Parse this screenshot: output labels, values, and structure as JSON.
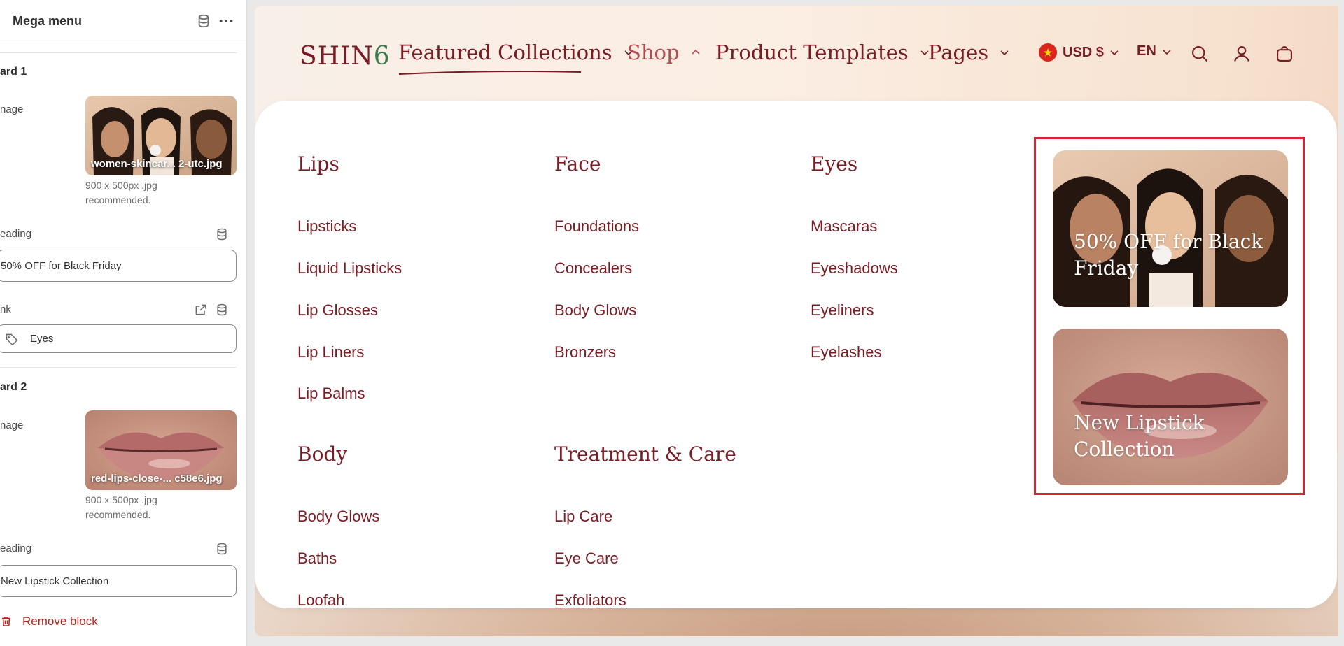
{
  "panel": {
    "title": "Mega menu",
    "card1": {
      "title": "ard 1",
      "image_label": "nage",
      "image_name": "women-skincar... 2-utc.jpg",
      "hint": "900 x 500px .jpg recommended.",
      "heading_label": "eading",
      "heading_value": "50% OFF for Black Friday",
      "link_label": "nk",
      "link_value": "Eyes"
    },
    "card2": {
      "title": "ard 2",
      "image_label": "nage",
      "image_name": "red-lips-close-... c58e6.jpg",
      "hint": "900 x 500px .jpg recommended.",
      "heading_label": "eading",
      "heading_value": "New Lipstick Collection"
    },
    "remove_label": "Remove block"
  },
  "store": {
    "logo": {
      "prefix": "SHIN",
      "leaf": "6"
    },
    "nav": [
      {
        "label": "Featured Collections"
      },
      {
        "label": "Shop"
      },
      {
        "label": "Product Templates"
      },
      {
        "label": "Pages"
      }
    ],
    "currency": "USD $",
    "language": "EN",
    "icons": [
      "search-icon",
      "account-icon",
      "cart-icon"
    ],
    "colors": {
      "brand": "#7a1c24",
      "highlight": "#d62231"
    }
  },
  "mega_menu": {
    "columns": [
      {
        "heading": "Lips",
        "links": [
          "Lipsticks",
          "Liquid Lipsticks",
          "Lip Glosses",
          "Lip Liners",
          "Lip Balms"
        ]
      },
      {
        "heading": "Face",
        "links": [
          "Foundations",
          "Concealers",
          "Body Glows",
          "Bronzers"
        ]
      },
      {
        "heading": "Eyes",
        "links": [
          "Mascaras",
          "Eyeshadows",
          "Eyeliners",
          "Eyelashes"
        ]
      },
      {
        "heading": "Body",
        "links": [
          "Body Glows",
          "Baths",
          "Loofah"
        ]
      },
      {
        "heading": "Treatment & Care",
        "links": [
          "Lip Care",
          "Eye Care",
          "Exfoliators"
        ]
      }
    ],
    "promo_cards": [
      {
        "heading": "50% OFF for Black Friday"
      },
      {
        "heading": "New Lipstick Collection"
      }
    ]
  }
}
